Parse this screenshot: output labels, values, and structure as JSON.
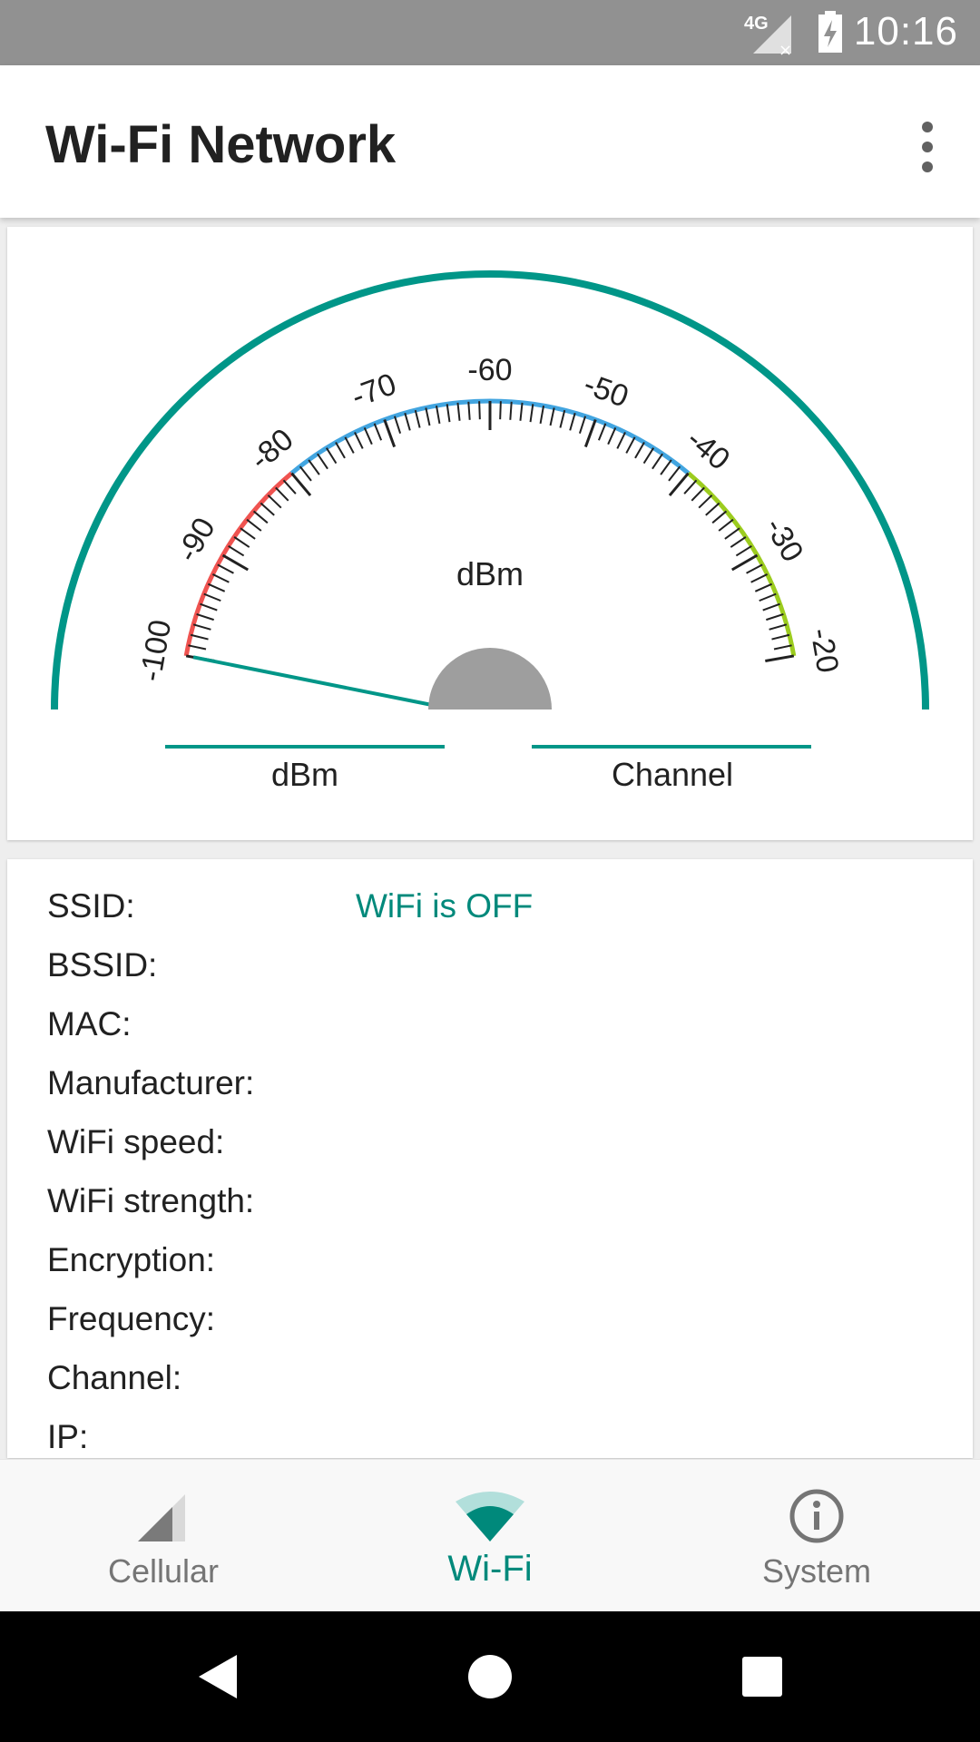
{
  "status_bar": {
    "time": "10:16",
    "network_type": "4G",
    "icons": [
      "cellular-signal-no-service-icon",
      "battery-charging-icon"
    ]
  },
  "app_bar": {
    "title": "Wi-Fi Network",
    "overflow_icon": "more-vert-icon"
  },
  "gauge": {
    "unit": "dBm",
    "current_value": -100,
    "range": [
      -100,
      -20
    ],
    "tick_labels": [
      "-100",
      "-90",
      "-80",
      "-70",
      "-60",
      "-50",
      "-40",
      "-30",
      "-20"
    ],
    "zones": [
      {
        "from": -100,
        "to": -80,
        "color": "#ef5350"
      },
      {
        "from": -80,
        "to": -40,
        "color": "#42a5e0"
      },
      {
        "from": -40,
        "to": -20,
        "color": "#9ccc1e"
      }
    ],
    "arc_color": "#009688",
    "readouts": [
      {
        "label": "dBm",
        "value": ""
      },
      {
        "label": "Channel",
        "value": ""
      }
    ]
  },
  "info": {
    "rows": [
      {
        "label": "SSID:",
        "value": "WiFi is OFF"
      },
      {
        "label": "BSSID:",
        "value": ""
      },
      {
        "label": "MAC:",
        "value": ""
      },
      {
        "label": "Manufacturer:",
        "value": ""
      },
      {
        "label": "WiFi speed:",
        "value": ""
      },
      {
        "label": "WiFi strength:",
        "value": ""
      },
      {
        "label": "Encryption:",
        "value": ""
      },
      {
        "label": "Frequency:",
        "value": ""
      },
      {
        "label": "Channel:",
        "value": ""
      },
      {
        "label": "IP:",
        "value": ""
      }
    ]
  },
  "bottom_nav": {
    "items": [
      {
        "label": "Cellular",
        "icon": "cellular-signal-icon",
        "active": false
      },
      {
        "label": "Wi-Fi",
        "icon": "wifi-icon",
        "active": true
      },
      {
        "label": "System",
        "icon": "info-icon",
        "active": false
      }
    ]
  },
  "colors": {
    "accent": "#00897b",
    "gauge_arc": "#009688"
  }
}
